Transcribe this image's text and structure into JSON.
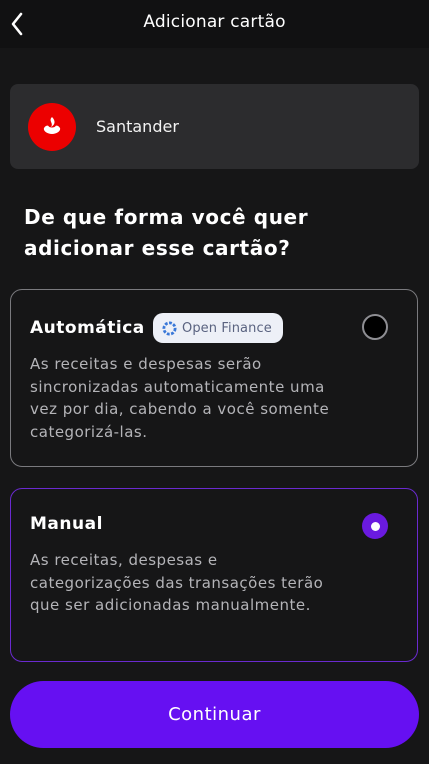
{
  "header": {
    "title": "Adicionar cartão",
    "back_icon": "chevron-left-icon"
  },
  "bank": {
    "name": "Santander",
    "logo_icon": "santander-flame-icon",
    "logo_color": "#ec0000"
  },
  "question": "De que forma você quer adicionar esse cartão?",
  "options": [
    {
      "title": "Automática",
      "badge": "Open Finance",
      "badge_icon": "open-finance-icon",
      "description": "As receitas e despesas serão sincronizadas automaticamente uma vez por dia, cabendo a você somente categorizá-las.",
      "selected": false
    },
    {
      "title": "Manual",
      "description": "As receitas, despesas e categorizações das transações terão que ser adicionadas manualmente.",
      "selected": true
    }
  ],
  "continue_button": {
    "label": "Continuar"
  },
  "colors": {
    "background": "#161617",
    "accent": "#6610f2",
    "selected_border": "#6a2ad0",
    "card": "#2c2c2e"
  }
}
